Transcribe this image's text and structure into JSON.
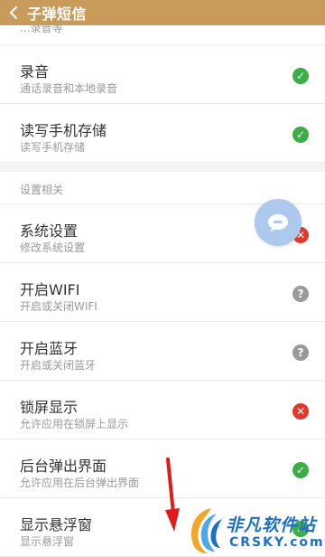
{
  "header": {
    "title": "子弹短信"
  },
  "partial_row": {
    "subtitle": "...录音等"
  },
  "rows_top": [
    {
      "title": "录音",
      "subtitle": "通话录音和本地录音",
      "status": "ok"
    },
    {
      "title": "读写手机存储",
      "subtitle": "读写手机存储",
      "status": "ok"
    }
  ],
  "section": {
    "title": "设置相关"
  },
  "rows_settings": [
    {
      "title": "系统设置",
      "subtitle": "修改系统设置",
      "status": "deny"
    },
    {
      "title": "开启WIFI",
      "subtitle": "开启或关闭WIFI",
      "status": "unknown"
    },
    {
      "title": "开启蓝牙",
      "subtitle": "开启或关闭蓝牙",
      "status": "unknown"
    },
    {
      "title": "锁屏显示",
      "subtitle": "允许应用在锁屏上显示",
      "status": "deny"
    },
    {
      "title": "后台弹出界面",
      "subtitle": "允许应用在后台弹出界面",
      "status": "ok"
    },
    {
      "title": "显示悬浮窗",
      "subtitle": "显示悬浮窗",
      "status": "ok"
    }
  ],
  "status_glyphs": {
    "ok": "✓",
    "deny": "✕",
    "unknown": "?"
  },
  "colors": {
    "header_bg": "#c99b5b",
    "ok": "#3cae47",
    "deny": "#e0392b",
    "unknown": "#9a9a9a",
    "fab": "#adc9ee",
    "annotation_arrow": "#e11b1b",
    "watermark": "#1d6fc7"
  },
  "watermark": {
    "name_cn": "非凡软件站",
    "name_en": "CRSKY.com"
  },
  "icons": {
    "back": "chevron-left-icon",
    "fab": "chat-bubble-icon",
    "ok": "check-icon",
    "deny": "close-icon",
    "unknown": "question-icon"
  }
}
